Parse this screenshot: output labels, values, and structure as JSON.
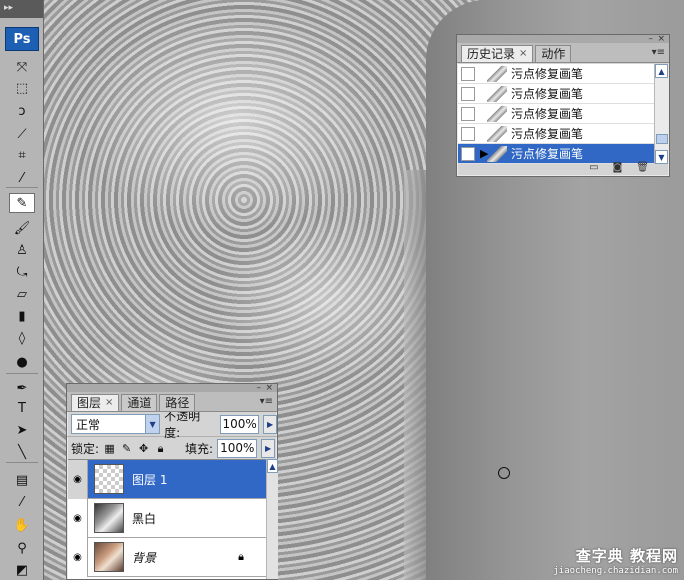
{
  "toolbox": {
    "logo": "Ps",
    "tools": [
      {
        "name": "move-tool-icon",
        "glyph": "⤧"
      },
      {
        "name": "marquee-tool-icon",
        "glyph": "⬚"
      },
      {
        "name": "lasso-tool-icon",
        "glyph": "ↄ"
      },
      {
        "name": "magic-wand-tool-icon",
        "glyph": "⟋"
      },
      {
        "name": "crop-tool-icon",
        "glyph": "⌗"
      },
      {
        "name": "eyedropper-tool-icon",
        "glyph": "⁄"
      },
      {
        "name": "spot-healing-brush-tool-icon",
        "glyph": "✎"
      },
      {
        "name": "brush-tool-icon",
        "glyph": "🖌"
      },
      {
        "name": "clone-stamp-tool-icon",
        "glyph": "♙"
      },
      {
        "name": "history-brush-tool-icon",
        "glyph": "⤿"
      },
      {
        "name": "eraser-tool-icon",
        "glyph": "▱"
      },
      {
        "name": "gradient-tool-icon",
        "glyph": "▮"
      },
      {
        "name": "blur-tool-icon",
        "glyph": "◊"
      },
      {
        "name": "dodge-tool-icon",
        "glyph": "●"
      },
      {
        "name": "pen-tool-icon",
        "glyph": "✒"
      },
      {
        "name": "type-tool-icon",
        "glyph": "T"
      },
      {
        "name": "path-selection-tool-icon",
        "glyph": "➤"
      },
      {
        "name": "line-tool-icon",
        "glyph": "╲"
      },
      {
        "name": "notes-tool-icon",
        "glyph": "▤"
      },
      {
        "name": "eyedropper2-tool-icon",
        "glyph": "⁄"
      },
      {
        "name": "hand-tool-icon",
        "glyph": "✋"
      },
      {
        "name": "zoom-tool-icon",
        "glyph": "⚲"
      },
      {
        "name": "color-swatch-icon",
        "glyph": "◩"
      }
    ]
  },
  "history_panel": {
    "tabs": [
      {
        "label": "历史记录",
        "close": "×"
      },
      {
        "label": "动作"
      }
    ],
    "items": [
      {
        "label": "污点修复画笔",
        "selected": false
      },
      {
        "label": "污点修复画笔",
        "selected": false
      },
      {
        "label": "污点修复画笔",
        "selected": false
      },
      {
        "label": "污点修复画笔",
        "selected": false
      },
      {
        "label": "污点修复画笔",
        "selected": true
      }
    ]
  },
  "layers_panel": {
    "tabs": [
      {
        "label": "图层",
        "close": "×"
      },
      {
        "label": "通道"
      },
      {
        "label": "路径"
      }
    ],
    "blend_mode": "正常",
    "opacity_label": "不透明度:",
    "opacity_value": "100%",
    "lock_label": "锁定:",
    "fill_label": "填充:",
    "fill_value": "100%",
    "layers": [
      {
        "name": "图层 1",
        "selected": true,
        "thumb": "transparent"
      },
      {
        "name": "黑白",
        "selected": false,
        "thumb": "photo"
      },
      {
        "name": "背景",
        "selected": false,
        "thumb": "color",
        "locked": true
      }
    ]
  },
  "watermark": {
    "title": "查字典 教程网",
    "url": "jiaocheng.chazidian.com"
  }
}
